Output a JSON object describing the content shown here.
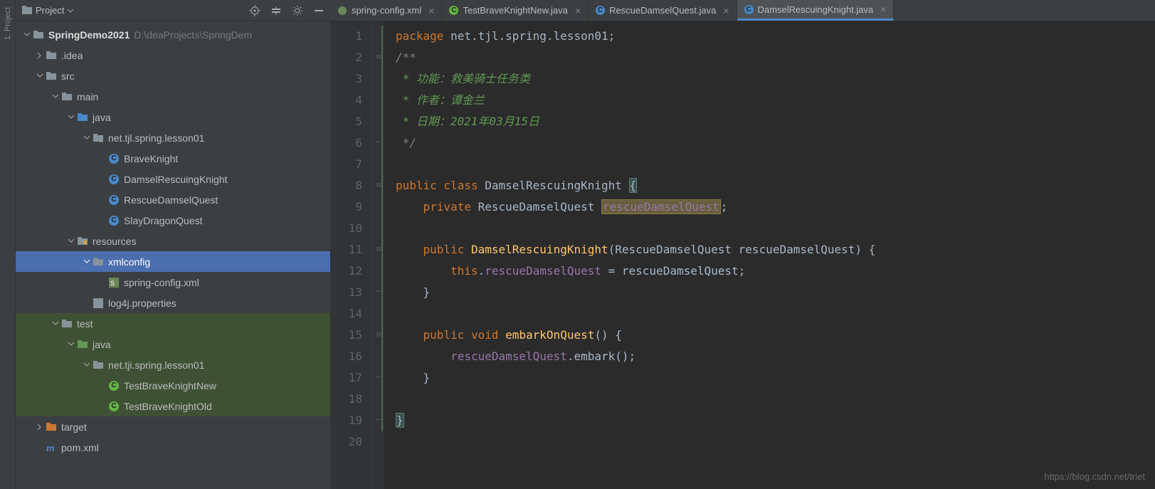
{
  "sidebar": {
    "title": "Project",
    "root": {
      "name": "SpringDemo2021",
      "path": "D:\\deaProjects\\SpringDem"
    },
    "items": {
      "idea": ".idea",
      "src": "src",
      "main": "main",
      "java": "java",
      "pkg1": "net.tjl.spring.lesson01",
      "c1": "BraveKnight",
      "c2": "DamselRescuingKnight",
      "c3": "RescueDamselQuest",
      "c4": "SlayDragonQuest",
      "resources": "resources",
      "xmlconfig": "xmlconfig",
      "springconfig": "spring-config.xml",
      "log4j": "log4j.properties",
      "test": "test",
      "javatest": "java",
      "pkgtest": "net.tji.spring.lesson01",
      "t1": "TestBraveKnightNew",
      "t2": "TestBraveKnightOld",
      "target": "target",
      "pom": "pom.xml"
    }
  },
  "tabs": {
    "t1": "spring-config.xml",
    "t2": "TestBraveKnightNew.java",
    "t3": "RescueDamselQuest.java",
    "t4": "DamselRescuingKnight.java"
  },
  "code": {
    "l1a": "package",
    "l1b": " net.tjl.spring.lesson01;",
    "l2": "/**",
    "l3": " * 功能：救美骑士任务类",
    "l4": " * 作者：谭金兰",
    "l5": " * 日期：2021年03月15日",
    "l6": " */",
    "l8a": "public class ",
    "l8b": "DamselRescuingKnight ",
    "l8c": "{",
    "l9a": "    ",
    "l9b": "private ",
    "l9c": "RescueDamselQuest ",
    "l9d": "rescueDamselQuest",
    "l9e": ";",
    "l11a": "    ",
    "l11b": "public ",
    "l11c": "DamselRescuingKnight",
    "l11d": "(RescueDamselQuest rescueDamselQuest) {",
    "l12a": "        ",
    "l12b": "this",
    "l12c": ".",
    "l12d": "rescueDamselQuest ",
    "l12e": "= rescueDamselQuest;",
    "l13": "    }",
    "l15a": "    ",
    "l15b": "public void ",
    "l15c": "embarkOnQuest",
    "l15d": "() {",
    "l16a": "        ",
    "l16b": "rescueDamselQuest",
    "l16c": ".embark();",
    "l17": "    }",
    "l19": "}"
  },
  "lines": [
    "1",
    "2",
    "3",
    "4",
    "5",
    "6",
    "7",
    "8",
    "9",
    "10",
    "11",
    "12",
    "13",
    "14",
    "15",
    "16",
    "17",
    "18",
    "19",
    "20"
  ],
  "watermark": "https://blog.csdn.net/triet"
}
